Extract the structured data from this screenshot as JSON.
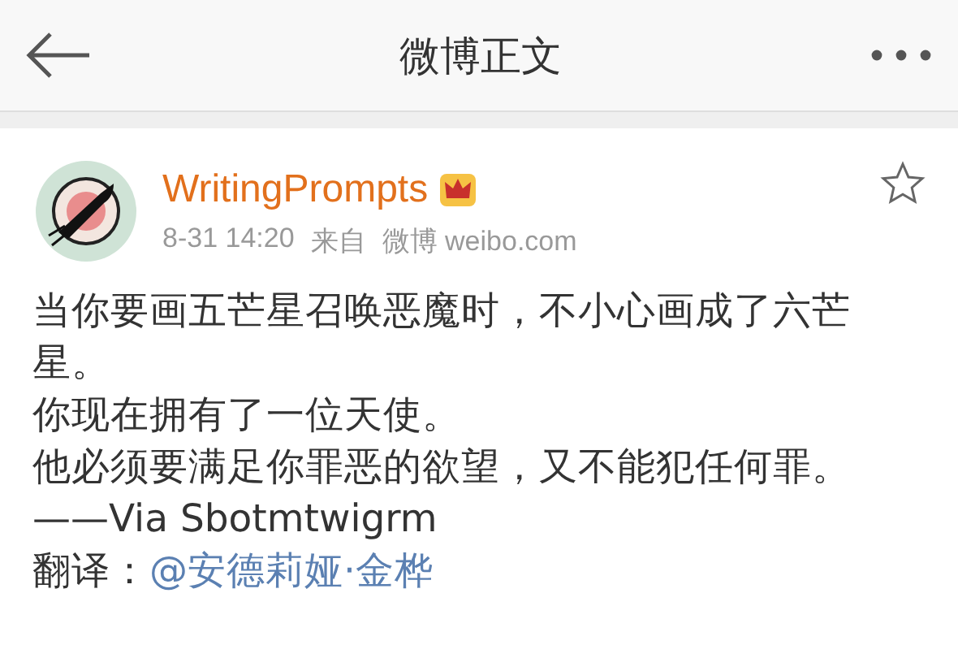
{
  "header": {
    "title": "微博正文"
  },
  "post": {
    "author": "WritingPrompts",
    "time": "8-31 14:20",
    "source_label": "来自",
    "source": "微博 weibo.com",
    "starred": false,
    "paragraphs": [
      "当你要画五芒星召唤恶魔时，不小心画成了六芒星。",
      "你现在拥有了一位天使。",
      "他必须要满足你罪恶的欲望，又不能犯任何罪。",
      "——Via Sbotmtwigrm"
    ],
    "credit": {
      "label": "翻译：",
      "link": "@安德莉娅·金桦"
    }
  }
}
